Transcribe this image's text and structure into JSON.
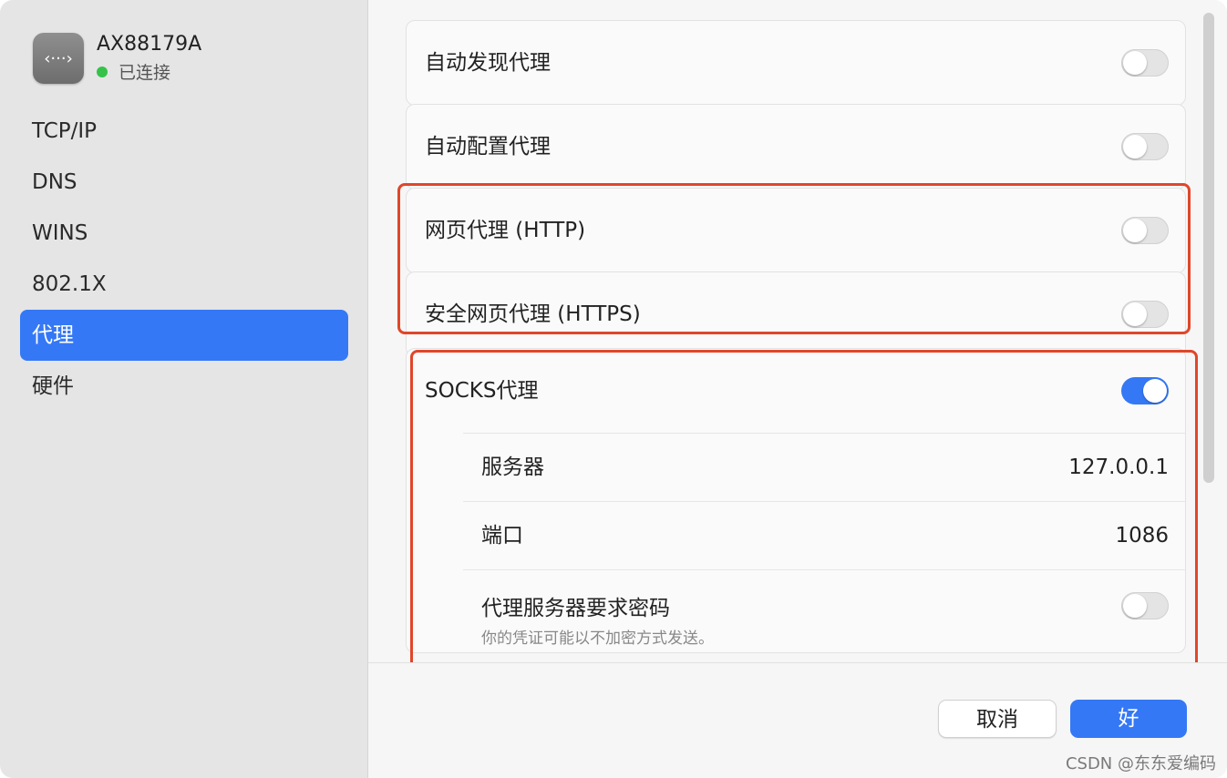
{
  "sidebar": {
    "device": {
      "icon": "‹···›",
      "name": "AX88179A",
      "status": "已连接",
      "status_color": "#35c24a"
    },
    "items": [
      {
        "label": "TCP/IP",
        "selected": false
      },
      {
        "label": "DNS",
        "selected": false
      },
      {
        "label": "WINS",
        "selected": false
      },
      {
        "label": "802.1X",
        "selected": false
      },
      {
        "label": "代理",
        "selected": true
      },
      {
        "label": "硬件",
        "selected": false
      }
    ]
  },
  "proxies": {
    "auto_discovery": {
      "label": "自动发现代理",
      "enabled": false
    },
    "auto_config": {
      "label": "自动配置代理",
      "enabled": false
    },
    "http": {
      "label": "网页代理 (HTTP)",
      "enabled": false
    },
    "https": {
      "label": "安全网页代理 (HTTPS)",
      "enabled": false
    },
    "socks": {
      "label": "SOCKS代理",
      "enabled": true,
      "server_label": "服务器",
      "server_value": "127.0.0.1",
      "port_label": "端口",
      "port_value": "1086",
      "password_label": "代理服务器要求密码",
      "password_hint": "你的凭证可能以不加密方式发送。",
      "password_enabled": false
    }
  },
  "footer": {
    "cancel_label": "取消",
    "ok_label": "好"
  },
  "watermark": "CSDN @东东爱编码",
  "colors": {
    "accent": "#3478f6",
    "highlight": "#e0462a"
  }
}
